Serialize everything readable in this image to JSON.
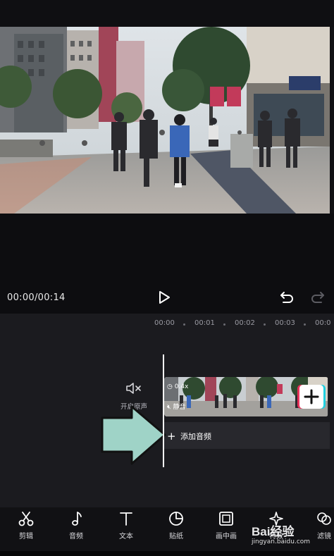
{
  "player": {
    "time_display": "00:00/00:14"
  },
  "timeline": {
    "ruler": [
      "00:00",
      "00:01",
      "00:02",
      "00:03",
      "00:0"
    ],
    "mute_toggle_label": "开启原声",
    "clip_speed": "0.4x",
    "clip_mute_badge": "静音",
    "add_audio_label": "添加音频"
  },
  "toolbar": {
    "items": [
      {
        "label": "剪辑",
        "icon": "scissors-icon"
      },
      {
        "label": "音频",
        "icon": "music-note-icon"
      },
      {
        "label": "文本",
        "icon": "text-icon"
      },
      {
        "label": "贴纸",
        "icon": "sticker-icon"
      },
      {
        "label": "画中画",
        "icon": "picture-in-picture-icon"
      },
      {
        "label": "特效",
        "icon": "sparkle-icon"
      },
      {
        "label": "滤镜",
        "icon": "filter-icon"
      }
    ]
  },
  "watermark": {
    "brand": "Bai经验",
    "url": "jingyan.baidu.com"
  },
  "colors": {
    "accent_arrow": "#9fd3c7",
    "timeline_bg": "#1b1b1f",
    "clip_add_red": "#e8325a",
    "clip_add_cyan": "#20d0e0"
  }
}
